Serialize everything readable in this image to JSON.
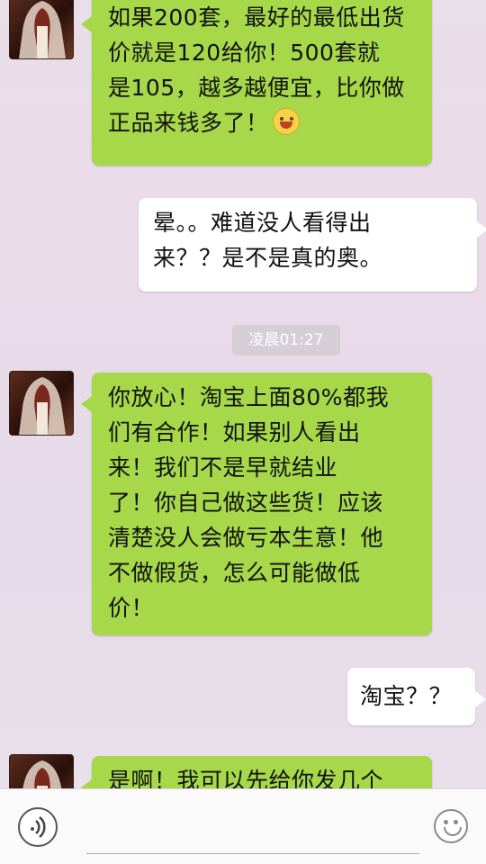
{
  "messages": [
    {
      "side": "in",
      "lines": [
        "如果200套，最好的最低出货",
        "价就是120给你！500套就",
        "是105，越多越便宜，比你做",
        "正品来钱多了！"
      ],
      "emoji": "smile-emoji"
    },
    {
      "side": "out",
      "lines": [
        "晕。。难道没人看得出",
        "来？？是不是真的奥。"
      ]
    },
    {
      "side": "in",
      "lines": [
        "你放心！淘宝上面80%都我",
        "们有合作！如果别人看出",
        "来！我们不是早就结业",
        "了！你自己做这些货！应该",
        "清楚没人会做亏本生意！他",
        "不做假货，怎么可能做低",
        "价！"
      ]
    },
    {
      "side": "out",
      "lines": [
        "淘宝？？"
      ]
    },
    {
      "side": "in",
      "lines": [
        "是啊！我可以先给你发几个"
      ]
    }
  ],
  "timestamp": "凌晨01:27",
  "input_bar": {
    "voice_icon": "voice-icon",
    "input_placeholder": "",
    "emoji_icon": "emoji-icon"
  },
  "colors": {
    "incoming_bubble": "#a6d84a",
    "outgoing_bubble": "#ffffff",
    "background": "#e9dfe8"
  }
}
